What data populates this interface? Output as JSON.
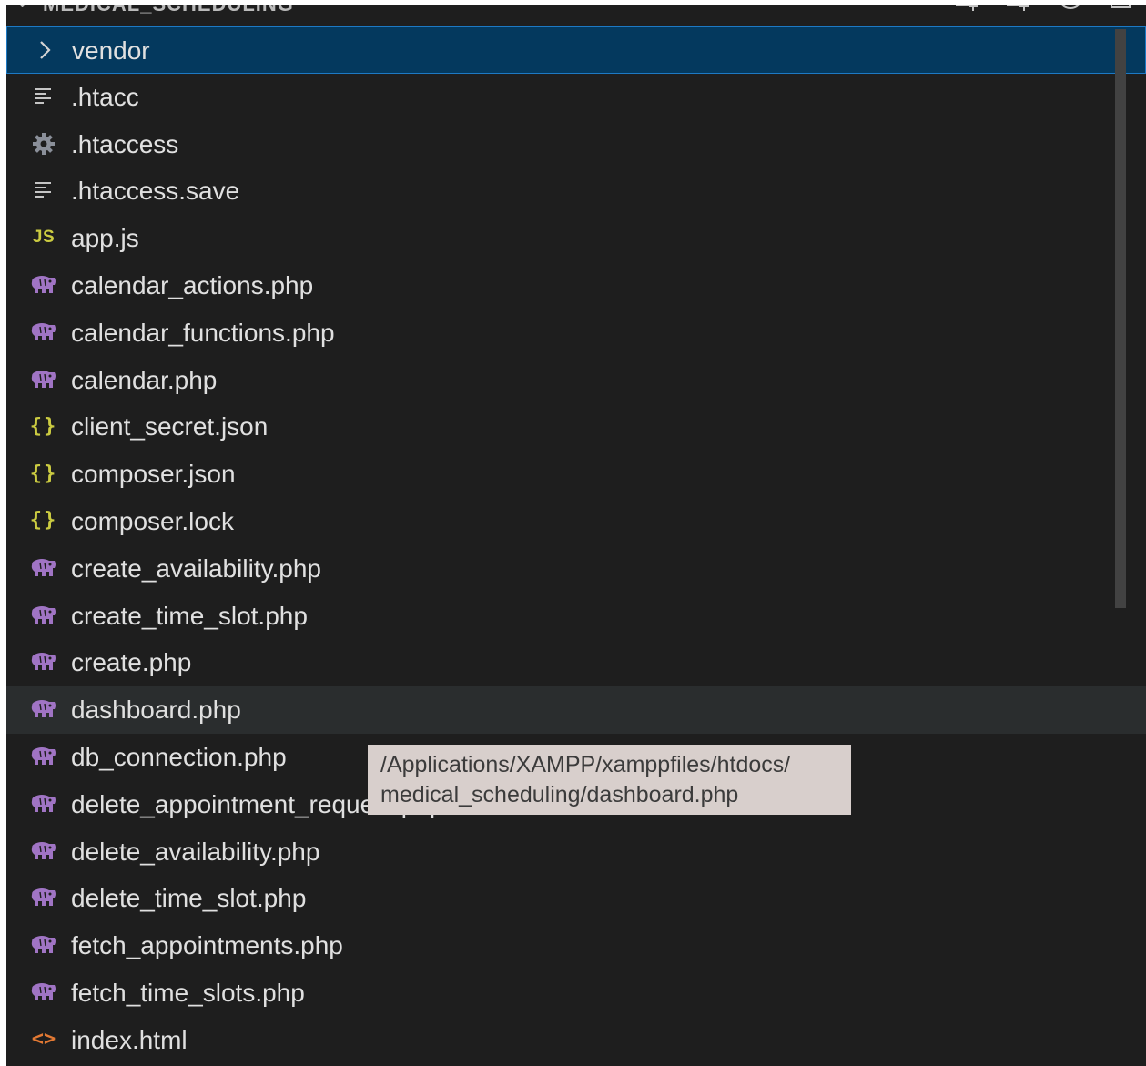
{
  "explorer": {
    "folder_title": "MEDICAL_SCHEDULING",
    "colors": {
      "background": "#1e1e1e",
      "selection": "#04395e",
      "selection_border": "#1d79c4",
      "hover": "#2a2d2e",
      "php_icon": "#a074c4",
      "json_icon": "#cbcb41",
      "js_icon": "#cbcb41",
      "html_icon": "#e37933"
    },
    "header_actions": [
      "new-file-icon",
      "new-folder-icon",
      "refresh-icon",
      "collapse-all-icon"
    ],
    "items": [
      {
        "label": "vendor",
        "icon": "chevron-right-icon",
        "kind": "folder",
        "state": "selected"
      },
      {
        "label": ".htacc",
        "icon": "text-lines-icon",
        "kind": "file"
      },
      {
        "label": ".htaccess",
        "icon": "gear-icon",
        "kind": "file"
      },
      {
        "label": ".htaccess.save",
        "icon": "text-lines-icon",
        "kind": "file"
      },
      {
        "label": "app.js",
        "icon": "js-icon",
        "kind": "file",
        "icon_text": "JS"
      },
      {
        "label": "calendar_actions.php",
        "icon": "php-elephant-icon",
        "kind": "file"
      },
      {
        "label": "calendar_functions.php",
        "icon": "php-elephant-icon",
        "kind": "file"
      },
      {
        "label": "calendar.php",
        "icon": "php-elephant-icon",
        "kind": "file"
      },
      {
        "label": "client_secret.json",
        "icon": "json-braces-icon",
        "kind": "file",
        "icon_text": "{}"
      },
      {
        "label": "composer.json",
        "icon": "json-braces-icon",
        "kind": "file",
        "icon_text": "{}"
      },
      {
        "label": "composer.lock",
        "icon": "json-braces-icon",
        "kind": "file",
        "icon_text": "{}"
      },
      {
        "label": "create_availability.php",
        "icon": "php-elephant-icon",
        "kind": "file"
      },
      {
        "label": "create_time_slot.php",
        "icon": "php-elephant-icon",
        "kind": "file"
      },
      {
        "label": "create.php",
        "icon": "php-elephant-icon",
        "kind": "file"
      },
      {
        "label": "dashboard.php",
        "icon": "php-elephant-icon",
        "kind": "file",
        "state": "hover"
      },
      {
        "label": "db_connection.php",
        "icon": "php-elephant-icon",
        "kind": "file"
      },
      {
        "label": "delete_appointment_request.php",
        "icon": "php-elephant-icon",
        "kind": "file"
      },
      {
        "label": "delete_availability.php",
        "icon": "php-elephant-icon",
        "kind": "file"
      },
      {
        "label": "delete_time_slot.php",
        "icon": "php-elephant-icon",
        "kind": "file"
      },
      {
        "label": "fetch_appointments.php",
        "icon": "php-elephant-icon",
        "kind": "file"
      },
      {
        "label": "fetch_time_slots.php",
        "icon": "php-elephant-icon",
        "kind": "file"
      },
      {
        "label": "index.html",
        "icon": "html-brackets-icon",
        "kind": "file",
        "icon_text": "<>"
      }
    ]
  },
  "tooltip": {
    "line1": "/Applications/XAMPP/xamppfiles/htdocs/",
    "line2": "medical_scheduling/dashboard.php"
  }
}
